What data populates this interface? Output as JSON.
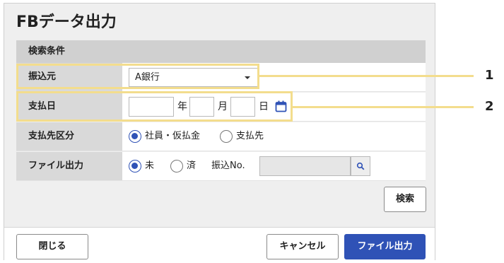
{
  "title": "FBデータ出力",
  "section_title": "検索条件",
  "fields": {
    "bank": {
      "label": "振込元",
      "value": "A銀行"
    },
    "date": {
      "label": "支払日",
      "year": "年",
      "month": "月",
      "day": "日"
    },
    "payee": {
      "label": "支払先区分",
      "option1": "社員・仮払金",
      "option2": "支払先",
      "selected": "社員・仮払金"
    },
    "file": {
      "label": "ファイル出力",
      "option1": "未",
      "option2": "済",
      "selected": "未",
      "transfer_label": "振込No."
    }
  },
  "buttons": {
    "search": "検索",
    "close": "閉じる",
    "cancel": "キャンセル",
    "export": "ファイル出力"
  },
  "callouts": [
    "1",
    "2"
  ],
  "colors": {
    "accent": "#2f52b6",
    "highlight": "#f3dd8d"
  }
}
